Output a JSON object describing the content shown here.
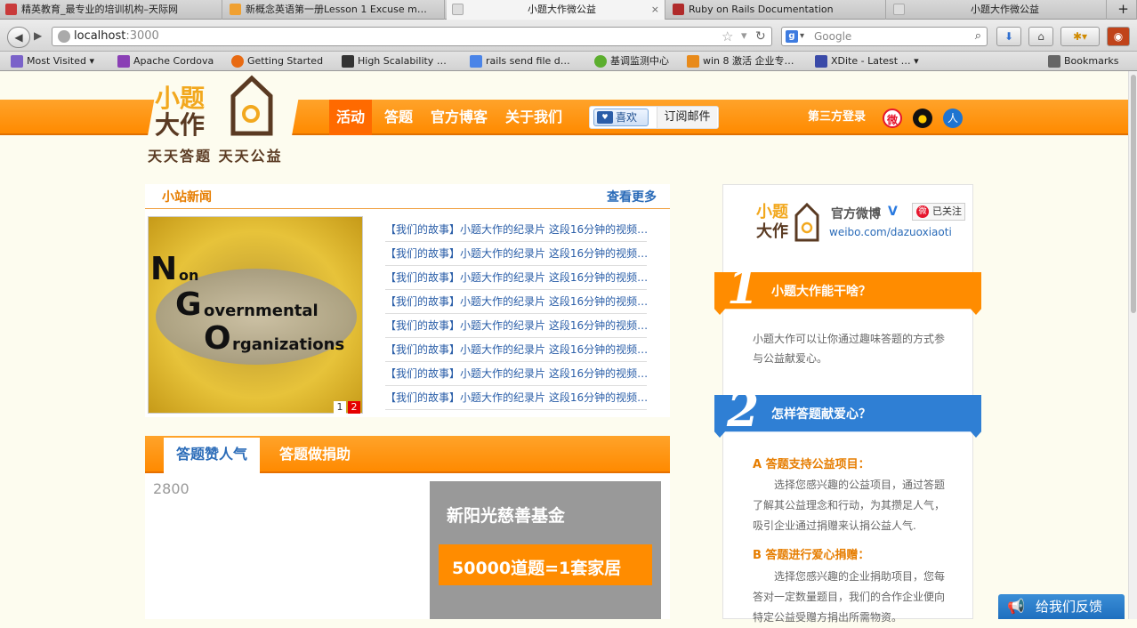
{
  "browser": {
    "tabs": [
      {
        "label": "精英教育_最专业的培训机构–天际网",
        "icon_color": "#c93a3a"
      },
      {
        "label": "新概念英语第一册Lesson 1 Excuse m…",
        "icon_color": "#f0a030"
      },
      {
        "label": "小题大作微公益",
        "icon_color": "#dddddd"
      },
      {
        "label": "Ruby on Rails Documentation",
        "icon_color": "#b02a2a"
      },
      {
        "label": "小题大作微公益",
        "icon_color": "#dddddd"
      }
    ],
    "close_glyph": "×",
    "new_tab_glyph": "+",
    "url_host": "localhost",
    "url_port": ":3000",
    "search_placeholder": "Google",
    "bookmarks": [
      {
        "label": "Most Visited",
        "icon_color": "#7a62c9"
      },
      {
        "label": "Apache Cordova",
        "icon_color": "#8a3fb5"
      },
      {
        "label": "Getting Started",
        "icon_color": "#e86a12"
      },
      {
        "label": "High Scalability …",
        "icon_color": "#333333"
      },
      {
        "label": "rails send file d…",
        "icon_color": "#4a84e8"
      },
      {
        "label": "基调监测中心",
        "icon_color": "#5cae2e"
      },
      {
        "label": "win 8 激活 企业专…",
        "icon_color": "#e88a1a"
      },
      {
        "label": "XDite - Latest …",
        "icon_color": "#3a4aa8"
      }
    ],
    "bookmarks_menu": "Bookmarks"
  },
  "site": {
    "logo_line1": "小题",
    "logo_line2": "大作",
    "logo_tagline": "天天答题 天天公益",
    "nav": [
      "活动",
      "答题",
      "官方博客",
      "关于我们"
    ],
    "like_label": "喜欢",
    "subscribe_label": "订阅邮件",
    "third_party_login": "第三方登录"
  },
  "news": {
    "title": "小站新闻",
    "more": "查看更多",
    "image_text": [
      "N",
      "on",
      "G",
      "overnmental",
      "O",
      "rganizations"
    ],
    "pages": [
      "1",
      "2"
    ],
    "items": [
      "【我们的故事】小题大作的纪录片 这段16分钟的视频…",
      "【我们的故事】小题大作的纪录片 这段16分钟的视频…",
      "【我们的故事】小题大作的纪录片 这段16分钟的视频…",
      "【我们的故事】小题大作的纪录片 这段16分钟的视频…",
      "【我们的故事】小题大作的纪录片 这段16分钟的视频…",
      "【我们的故事】小题大作的纪录片 这段16分钟的视频…",
      "【我们的故事】小题大作的纪录片 这段16分钟的视频…",
      "【我们的故事】小题大作的纪录片 这段16分钟的视频…"
    ]
  },
  "popular": {
    "tabs": [
      "答题赞人气",
      "答题做捐助"
    ],
    "count": "2800",
    "fund_name": "新阳光慈善基金",
    "fund_equation": "50000道题=1套家居"
  },
  "sidebar": {
    "weibo_name": "官方微博",
    "weibo_verified": "V",
    "follow_label": "已关注",
    "weibo_url": "weibo.com/dazuoxiaoti",
    "q1_num": "1",
    "q1_title": "小题大作能干啥？",
    "q1_body": "小题大作可以让你通过趣味答题的方式参与公益献爱心。",
    "q2_num": "2",
    "q2_title": "怎样答题献爱心？",
    "a_title": "A 答题支持公益项目：",
    "a_body": "选择您感兴趣的公益项目，通过答题了解其公益理念和行动，为其攒足人气，吸引企业通过捐赠来认捐公益人气.",
    "b_title": "B 答题进行爱心捐赠：",
    "b_body": "选择您感兴趣的企业捐助项目，您每答对一定数量题目，我们的合作企业便向特定公益受赠方捐出所需物资。"
  },
  "feedback": "给我们反馈",
  "colors": {
    "orange": "#ff8c00",
    "nav_active": "#ff6a00",
    "link_blue": "#2a6bb8",
    "q2_blue": "#2f7fd4"
  }
}
